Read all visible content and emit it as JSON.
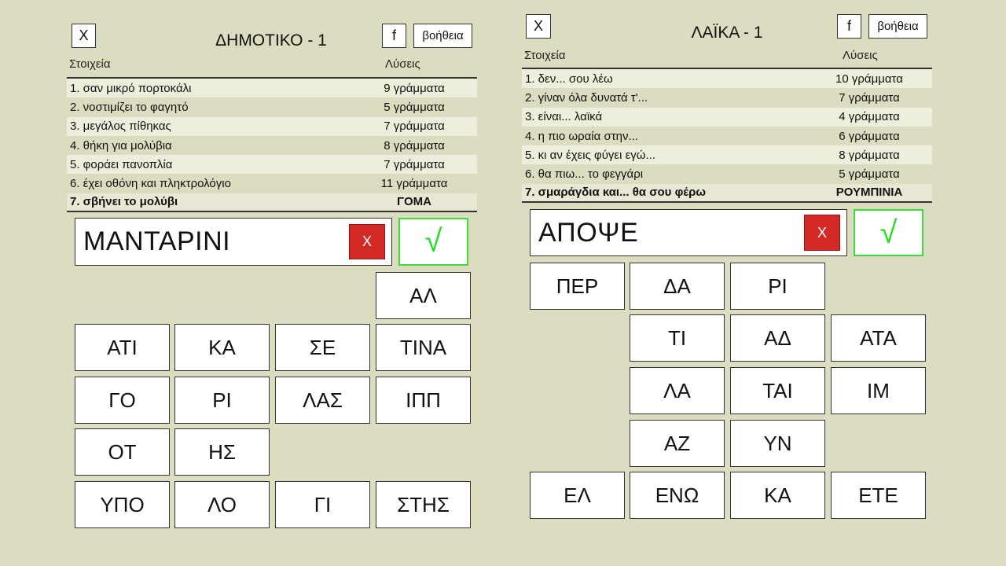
{
  "left": {
    "close_label": "X",
    "title": "ΔΗΜΟΤΙΚΟ - 1",
    "fb_label": "f",
    "help_label": "βοήθεια",
    "col_clues": "Στοιχεία",
    "col_solutions": "Λύσεις",
    "clues": [
      {
        "clue": "1. σαν μικρό πορτοκάλι",
        "solution": "9 γράμματα"
      },
      {
        "clue": "2. νοστιμίζει το φαγητό",
        "solution": "5 γράμματα"
      },
      {
        "clue": "3. μεγάλος πίθηκας",
        "solution": "7 γράμματα"
      },
      {
        "clue": "4. θήκη για μολύβια",
        "solution": "8 γράμματα"
      },
      {
        "clue": "5. φοράει πανοπλία",
        "solution": "7 γράμματα"
      },
      {
        "clue": "6. έχει οθόνη και πληκτρολόγιο",
        "solution": "11 γράμματα"
      },
      {
        "clue": "7. σβήνει το μολύβι",
        "solution": "ΓΟΜΑ"
      }
    ],
    "answer": "ΜΑΝΤΑΡΙΝΙ",
    "clear_label": "X",
    "check_label": "√",
    "tiles": [
      "ΑΛ",
      "ΑΤΙ",
      "ΚΑ",
      "ΣΕ",
      "ΤΙΝΑ",
      "ΓΟ",
      "ΡΙ",
      "ΛΑΣ",
      "ΙΠΠ",
      "ΟΤ",
      "ΗΣ",
      "ΥΠΟ",
      "ΛΟ",
      "ΓΙ",
      "ΣΤΗΣ"
    ]
  },
  "right": {
    "close_label": "X",
    "title": "ΛΑΪΚΑ - 1",
    "fb_label": "f",
    "help_label": "βοήθεια",
    "col_clues": "Στοιχεία",
    "col_solutions": "Λύσεις",
    "clues": [
      {
        "clue": "1. δεν... σου λέω",
        "solution": "10 γράμματα"
      },
      {
        "clue": "2. γίναν όλα δυνατά τ'...",
        "solution": "7 γράμματα"
      },
      {
        "clue": "3. είναι... λαϊκά",
        "solution": "4 γράμματα"
      },
      {
        "clue": "4. η πιο ωραία στην...",
        "solution": "6 γράμματα"
      },
      {
        "clue": "5. κι αν έχεις φύγει εγώ...",
        "solution": "8 γράμματα"
      },
      {
        "clue": "6. θα πιω... το φεγγάρι",
        "solution": "5 γράμματα"
      },
      {
        "clue": "7. σμαράγδια και... θα σου φέρω",
        "solution": "ΡΟΥΜΠΙΝΙΑ"
      }
    ],
    "answer": "ΑΠΟΨΕ",
    "clear_label": "X",
    "check_label": "√",
    "tiles": [
      "ΠΕΡ",
      "ΔΑ",
      "ΡΙ",
      "ΤΙ",
      "ΑΔ",
      "ΑΤΑ",
      "ΛΑ",
      "ΤΑΙ",
      "ΙΜ",
      "ΑΖ",
      "ΥΝ",
      "ΕΛ",
      "ΕΝΩ",
      "ΚΑ",
      "ΕΤΕ"
    ]
  }
}
